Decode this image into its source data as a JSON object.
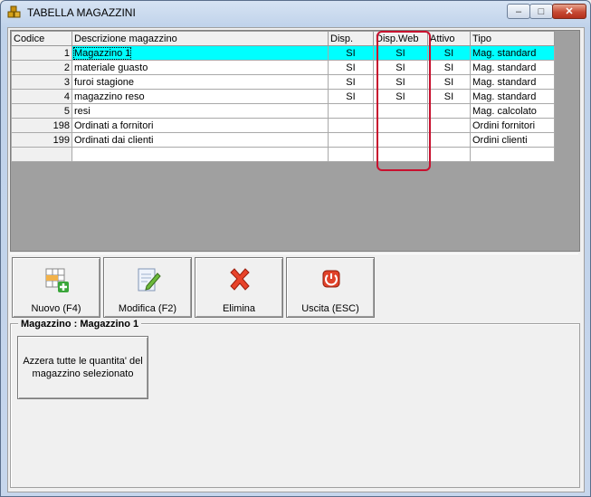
{
  "window": {
    "title": "TABELLA MAGAZZINI"
  },
  "grid": {
    "columns": [
      "Codice",
      "Descrizione magazzino",
      "Disp.",
      "Disp.Web",
      "Attivo",
      "Tipo"
    ],
    "rows": [
      {
        "codice": "1",
        "descrizione": "Magazzino 1",
        "disp": "SI",
        "disp_web": "SI",
        "attivo": "SI",
        "tipo": "Mag. standard",
        "selected": true
      },
      {
        "codice": "2",
        "descrizione": "materiale guasto",
        "disp": "SI",
        "disp_web": "SI",
        "attivo": "SI",
        "tipo": "Mag. standard"
      },
      {
        "codice": "3",
        "descrizione": "furoi stagione",
        "disp": "SI",
        "disp_web": "SI",
        "attivo": "SI",
        "tipo": "Mag. standard"
      },
      {
        "codice": "4",
        "descrizione": "magazzino reso",
        "disp": "SI",
        "disp_web": "SI",
        "attivo": "SI",
        "tipo": "Mag. standard"
      },
      {
        "codice": "5",
        "descrizione": "resi",
        "disp": "",
        "disp_web": "",
        "attivo": "",
        "tipo": "Mag. calcolato"
      },
      {
        "codice": "198",
        "descrizione": "Ordinati a fornitori",
        "disp": "",
        "disp_web": "",
        "attivo": "",
        "tipo": "Ordini fornitori"
      },
      {
        "codice": "199",
        "descrizione": "Ordinati dai clienti",
        "disp": "",
        "disp_web": "",
        "attivo": "",
        "tipo": "Ordini clienti"
      },
      {
        "codice": "",
        "descrizione": "",
        "disp": "",
        "disp_web": "",
        "attivo": "",
        "tipo": ""
      }
    ]
  },
  "toolbar": {
    "new_label": "Nuovo (F4)",
    "edit_label": "Modifica (F2)",
    "delete_label": "Elimina",
    "exit_label": "Uscita (ESC)"
  },
  "panel": {
    "title": "Magazzino : Magazzino 1",
    "reset_button_label": "Azzera tutte le quantita' del magazzino selezionato"
  },
  "colors": {
    "selection": "#00ffff",
    "highlight_box": "#c8102e"
  }
}
